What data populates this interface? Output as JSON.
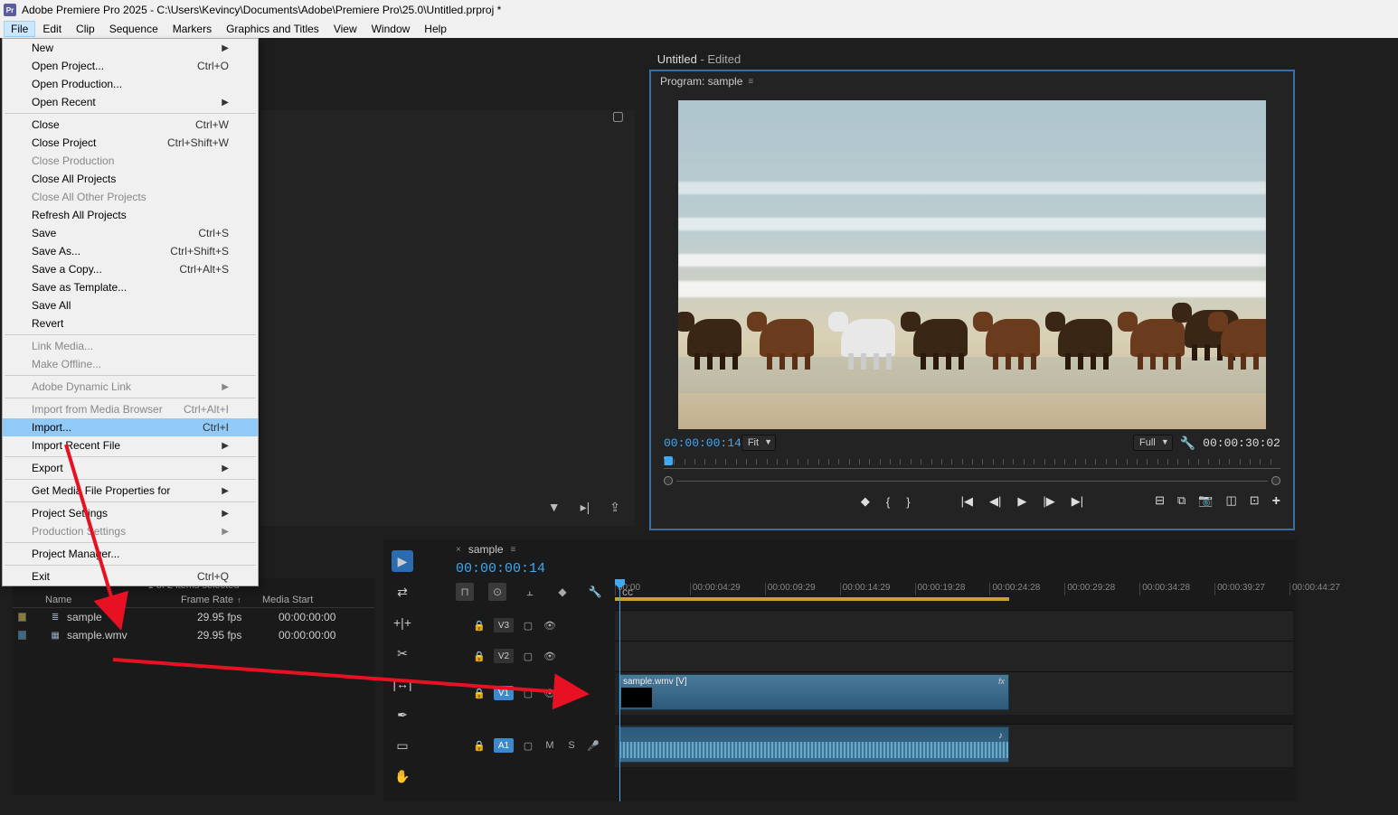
{
  "titlebar": {
    "logo": "Pr",
    "text": "Adobe Premiere Pro 2025 - C:\\Users\\Kevincy\\Documents\\Adobe\\Premiere Pro\\25.0\\Untitled.prproj *"
  },
  "menubar": [
    "File",
    "Edit",
    "Clip",
    "Sequence",
    "Markers",
    "Graphics and Titles",
    "View",
    "Window",
    "Help"
  ],
  "dropdown": [
    {
      "label": "New",
      "shortcut": "",
      "sub": true
    },
    {
      "label": "Open Project...",
      "shortcut": "Ctrl+O"
    },
    {
      "label": "Open Production..."
    },
    {
      "label": "Open Recent",
      "sub": true
    },
    {
      "sep": true
    },
    {
      "label": "Close",
      "shortcut": "Ctrl+W"
    },
    {
      "label": "Close Project",
      "shortcut": "Ctrl+Shift+W"
    },
    {
      "label": "Close Production",
      "disabled": true
    },
    {
      "label": "Close All Projects"
    },
    {
      "label": "Close All Other Projects",
      "disabled": true
    },
    {
      "label": "Refresh All Projects"
    },
    {
      "label": "Save",
      "shortcut": "Ctrl+S"
    },
    {
      "label": "Save As...",
      "shortcut": "Ctrl+Shift+S"
    },
    {
      "label": "Save a Copy...",
      "shortcut": "Ctrl+Alt+S"
    },
    {
      "label": "Save as Template..."
    },
    {
      "label": "Save All"
    },
    {
      "label": "Revert"
    },
    {
      "sep": true
    },
    {
      "label": "Link Media...",
      "disabled": true
    },
    {
      "label": "Make Offline...",
      "disabled": true
    },
    {
      "sep": true
    },
    {
      "label": "Adobe Dynamic Link",
      "sub": true,
      "disabled": true
    },
    {
      "sep": true
    },
    {
      "label": "Import from Media Browser",
      "shortcut": "Ctrl+Alt+I",
      "disabled": true
    },
    {
      "label": "Import...",
      "shortcut": "Ctrl+I",
      "highlighted": true
    },
    {
      "label": "Import Recent File",
      "sub": true
    },
    {
      "sep": true
    },
    {
      "label": "Export",
      "sub": true
    },
    {
      "sep": true
    },
    {
      "label": "Get Media File Properties for",
      "sub": true
    },
    {
      "sep": true
    },
    {
      "label": "Project Settings",
      "sub": true
    },
    {
      "label": "Production Settings",
      "sub": true,
      "disabled": true
    },
    {
      "sep": true
    },
    {
      "label": "Project Manager..."
    },
    {
      "sep": true
    },
    {
      "label": "Exit",
      "shortcut": "Ctrl+Q"
    }
  ],
  "tabTitle": {
    "main": "Untitled",
    "suffix": " - Edited"
  },
  "program": {
    "title": "Program: sample",
    "tc_left": "00:00:00:14",
    "fit": "Fit",
    "full": "Full",
    "tc_right": "00:00:30:02"
  },
  "project": {
    "status": "1 of 2 items selected",
    "cols": {
      "name": "Name",
      "fr": "Frame Rate",
      "ms": "Media Start"
    },
    "rows": [
      {
        "color": "yellow",
        "icon": "≣",
        "name": "sample",
        "fr": "29.95 fps",
        "ms": "00:00:00:00"
      },
      {
        "color": "blue",
        "icon": "▦",
        "name": "sample.wmv",
        "fr": "29.95 fps",
        "ms": "00:00:00:00"
      }
    ]
  },
  "timeline": {
    "seq": "sample",
    "tc": "00:00:00:14",
    "ticks": [
      "00:00",
      "00:00:04:29",
      "00:00:09:29",
      "00:00:14:29",
      "00:00:19:28",
      "00:00:24:28",
      "00:00:29:28",
      "00:00:34:28",
      "00:00:39:27",
      "00:00:44:27"
    ],
    "tracks": {
      "v3": "V3",
      "v2": "V2",
      "v1": "V1",
      "a1": "A1"
    },
    "m": "M",
    "s": "S",
    "clip": {
      "name": "sample.wmv [V]"
    }
  }
}
